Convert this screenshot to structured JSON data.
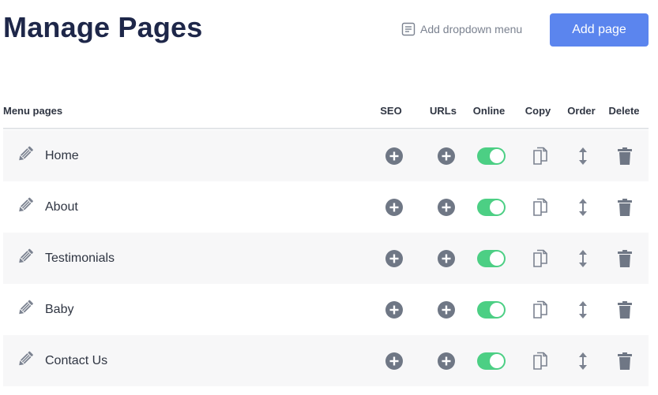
{
  "header": {
    "title": "Manage Pages",
    "add_dropdown_label": "Add dropdown menu",
    "add_page_label": "Add page"
  },
  "table": {
    "columns": {
      "menu_pages": "Menu pages",
      "seo": "SEO",
      "urls": "URLs",
      "online": "Online",
      "copy": "Copy",
      "order": "Order",
      "delete": "Delete"
    },
    "rows": [
      {
        "label": "Home",
        "online": true
      },
      {
        "label": "About",
        "online": true
      },
      {
        "label": "Testimonials",
        "online": true
      },
      {
        "label": "Baby",
        "online": true
      },
      {
        "label": "Contact Us",
        "online": true
      }
    ]
  },
  "colors": {
    "accent": "#5b85ee",
    "toggle_on": "#4ccf84",
    "icon": "#6f7785",
    "title": "#1e2749"
  },
  "icons": {
    "edit": "pencil-icon",
    "seo": "plus-circle-icon",
    "urls": "plus-circle-icon",
    "copy": "copy-icon",
    "order": "vertical-arrows-icon",
    "delete": "trash-icon",
    "dropdown": "document-icon"
  }
}
